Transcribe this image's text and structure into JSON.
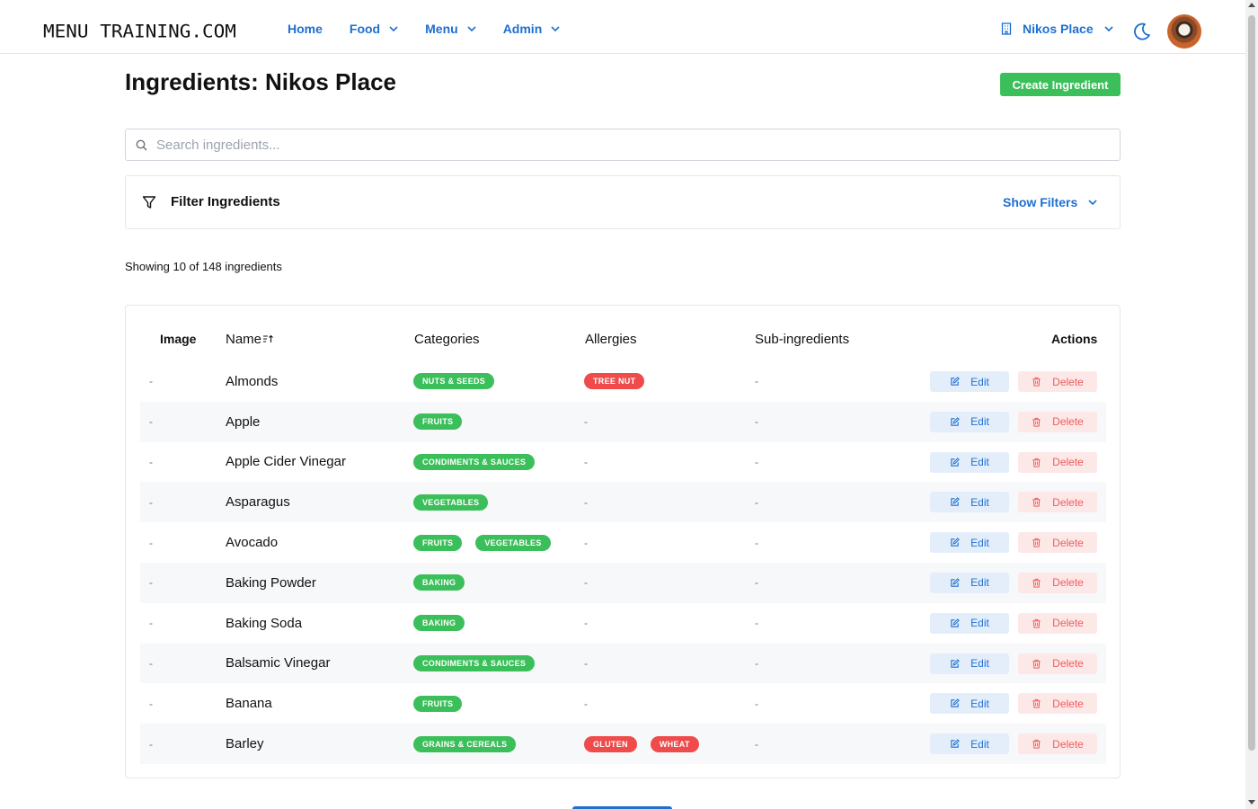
{
  "header": {
    "logo": "MENU TRAINING.COM",
    "nav": [
      {
        "label": "Home",
        "has_dropdown": false
      },
      {
        "label": "Food",
        "has_dropdown": true
      },
      {
        "label": "Menu",
        "has_dropdown": true
      },
      {
        "label": "Admin",
        "has_dropdown": true
      }
    ],
    "venue": "Nikos Place"
  },
  "page": {
    "title": "Ingredients: Nikos Place",
    "create_label": "Create Ingredient",
    "search_placeholder": "Search ingredients...",
    "filter_title": "Filter Ingredients",
    "show_filters_label": "Show Filters",
    "count_text": "Showing 10 of 148 ingredients"
  },
  "table": {
    "headers": {
      "image": "Image",
      "name": "Name",
      "categories": "Categories",
      "allergies": "Allergies",
      "subs": "Sub-ingredients",
      "actions": "Actions"
    },
    "empty": "-",
    "edit_label": "Edit",
    "delete_label": "Delete",
    "rows": [
      {
        "name": "Almonds",
        "categories": [
          "Nuts & Seeds"
        ],
        "allergies": [
          "Tree Nut"
        ]
      },
      {
        "name": "Apple",
        "categories": [
          "Fruits"
        ],
        "allergies": []
      },
      {
        "name": "Apple Cider Vinegar",
        "categories": [
          "Condiments & Sauces"
        ],
        "allergies": []
      },
      {
        "name": "Asparagus",
        "categories": [
          "Vegetables"
        ],
        "allergies": []
      },
      {
        "name": "Avocado",
        "categories": [
          "Fruits",
          "Vegetables"
        ],
        "allergies": []
      },
      {
        "name": "Baking Powder",
        "categories": [
          "Baking"
        ],
        "allergies": []
      },
      {
        "name": "Baking Soda",
        "categories": [
          "Baking"
        ],
        "allergies": []
      },
      {
        "name": "Balsamic Vinegar",
        "categories": [
          "Condiments & Sauces"
        ],
        "allergies": []
      },
      {
        "name": "Banana",
        "categories": [
          "Fruits"
        ],
        "allergies": []
      },
      {
        "name": "Barley",
        "categories": [
          "Grains & Cereals"
        ],
        "allergies": [
          "Gluten",
          "Wheat"
        ]
      }
    ]
  },
  "colors": {
    "accent": "#1d6fd1",
    "success": "#3bbf5a",
    "danger": "#ef4b4b"
  },
  "icons": [
    "chevron-down-icon",
    "building-icon",
    "moon-icon",
    "search-icon",
    "filter-icon",
    "sort-icon",
    "edit-icon",
    "trash-icon"
  ]
}
